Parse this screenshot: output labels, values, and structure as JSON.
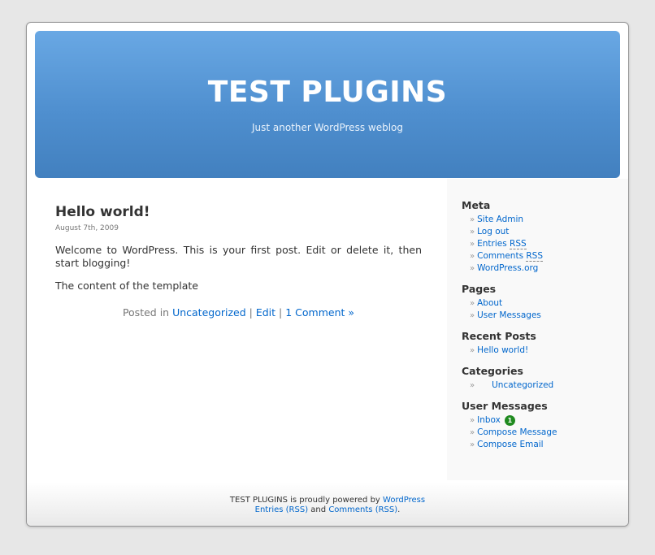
{
  "header": {
    "title": "TEST PLUGINS",
    "description": "Just another WordPress weblog"
  },
  "post": {
    "title": "Hello world!",
    "date": "August 7th, 2009",
    "paragraphs": [
      "Welcome to WordPress. This is your first post. Edit or delete it, then start blogging!",
      "The content of the template"
    ],
    "meta": {
      "posted_in": "Posted in",
      "category": "Uncategorized",
      "sep1": "|",
      "edit": "Edit",
      "sep2": "|",
      "comments": "1 Comment »"
    }
  },
  "sidebar": {
    "meta": {
      "heading": "Meta",
      "site_admin": "Site Admin",
      "log_out": "Log out",
      "entries_prefix": "Entries",
      "comments_prefix": "Comments",
      "rss": "RSS",
      "wordpress_org": "WordPress.org"
    },
    "pages": {
      "heading": "Pages",
      "items": [
        "About",
        "User Messages"
      ]
    },
    "recent_posts": {
      "heading": "Recent Posts",
      "items": [
        "Hello world!"
      ]
    },
    "categories": {
      "heading": "Categories",
      "items": [
        "Uncategorized"
      ]
    },
    "user_messages": {
      "heading": "User Messages",
      "inbox": "Inbox",
      "inbox_count": "1",
      "compose_message": "Compose Message",
      "compose_email": "Compose Email"
    },
    "bullet": "»"
  },
  "footer": {
    "powered_prefix": "TEST PLUGINS is proudly powered by",
    "wordpress": "WordPress",
    "entries_rss": "Entries (RSS)",
    "and": "and",
    "comments_rss": "Comments (RSS)",
    "period": "."
  },
  "colors": {
    "header_top": "#69a8e4",
    "header_bottom": "#4280bf",
    "link": "#0066cc",
    "badge": "#1f8a1f"
  }
}
